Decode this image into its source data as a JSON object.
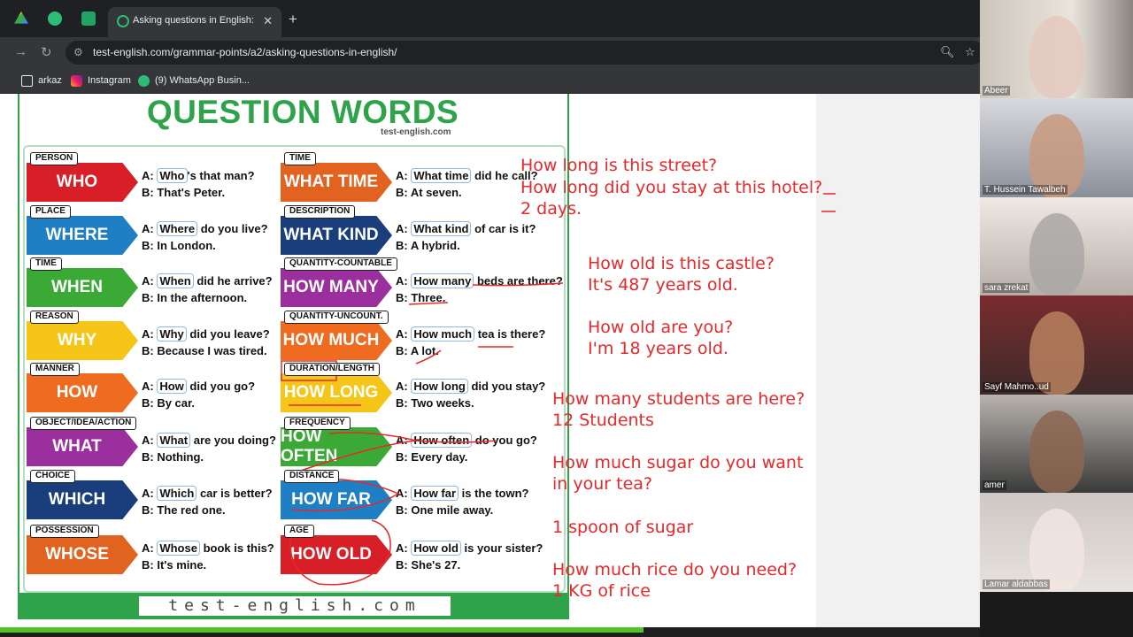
{
  "browser": {
    "active_tab_title": "Asking questions in English: Qu",
    "url": "test-english.com/grammar-points/a2/asking-questions-in-english/",
    "bookmarks": [
      {
        "label": "arkaz",
        "icon": "folder-icon"
      },
      {
        "label": "Instagram",
        "icon": "instagram-icon"
      },
      {
        "label": "(9) WhatsApp Busin...",
        "icon": "whatsapp-icon"
      }
    ],
    "close_glyph": "✕",
    "new_tab_glyph": "+"
  },
  "poster": {
    "title": "QUESTION WORDS",
    "brand": "test-english.com",
    "footer": "test-english.com",
    "cards": [
      {
        "cat": "PERSON",
        "word": "WHO",
        "color": "#d81e26",
        "pre1": "A: ",
        "hl": "Who",
        "post1": "'s that man?",
        "line2": "B: That's Peter."
      },
      {
        "cat": "PLACE",
        "word": "WHERE",
        "color": "#1e7fc4",
        "pre1": "A: ",
        "hl": "Where",
        "post1": " do you live?",
        "line2": "B: In London."
      },
      {
        "cat": "TIME",
        "word": "WHEN",
        "color": "#3aa935",
        "pre1": "A: ",
        "hl": "When",
        "post1": " did he arrive?",
        "line2": "B: In the afternoon."
      },
      {
        "cat": "REASON",
        "word": "WHY",
        "color": "#f5c518",
        "pre1": "A: ",
        "hl": "Why",
        "post1": " did you leave?",
        "line2": "B: Because I was tired."
      },
      {
        "cat": "MANNER",
        "word": "HOW",
        "color": "#ee6b1f",
        "pre1": "A: ",
        "hl": "How",
        "post1": " did you go?",
        "line2": "B: By car."
      },
      {
        "cat": "OBJECT/IDEA/ACTION",
        "word": "WHAT",
        "color": "#9b2f9e",
        "pre1": "A: ",
        "hl": "What",
        "post1": " are you doing?",
        "line2": "B: Nothing."
      },
      {
        "cat": "CHOICE",
        "word": "WHICH",
        "color": "#1a3d7c",
        "pre1": "A: ",
        "hl": "Which",
        "post1": " car is better?",
        "line2": "B: The red one."
      },
      {
        "cat": "POSSESSION",
        "word": "WHOSE",
        "color": "#e2621f",
        "pre1": "A: ",
        "hl": "Whose",
        "post1": " book is this?",
        "line2": "B: It's mine."
      },
      {
        "cat": "TIME",
        "word": "WHAT TIME",
        "color": "#e2621f",
        "pre1": "A: ",
        "hl": "What time",
        "post1": " did he call?",
        "line2": "B: At seven."
      },
      {
        "cat": "DESCRIPTION",
        "word": "WHAT KIND",
        "color": "#1a3d7c",
        "pre1": "A: ",
        "hl": "What kind",
        "post1": " of car is it?",
        "line2": "B: A hybrid."
      },
      {
        "cat": "QUANTITY-COUNTABLE",
        "word": "HOW MANY",
        "color": "#9b2f9e",
        "pre1": "A: ",
        "hl": "How many",
        "post1": " beds are there?",
        "line2": "B: Three."
      },
      {
        "cat": "QUANTITY-UNCOUNT.",
        "word": "HOW MUCH",
        "color": "#ee6b1f",
        "pre1": "A: ",
        "hl": "How much",
        "post1": " tea is there?",
        "line2": "B: A lot."
      },
      {
        "cat": "DURATION/LENGTH",
        "word": "HOW LONG",
        "color": "#f5c518",
        "pre1": "A: ",
        "hl": "How long",
        "post1": " did you stay?",
        "line2": "B: Two weeks."
      },
      {
        "cat": "FREQUENCY",
        "word": "HOW OFTEN",
        "color": "#3aa935",
        "pre1": "A: ",
        "hl": "How often",
        "post1": " do you go?",
        "line2": "B: Every day."
      },
      {
        "cat": "DISTANCE",
        "word": "HOW FAR",
        "color": "#1e7fc4",
        "pre1": "A: ",
        "hl": "How far",
        "post1": " is the town?",
        "line2": "B: One mile away."
      },
      {
        "cat": "AGE",
        "word": "HOW OLD",
        "color": "#d81e26",
        "pre1": "A: ",
        "hl": "How old",
        "post1": " is your sister?",
        "line2": "B: She's 27."
      }
    ]
  },
  "notes": [
    "How long is this street?",
    "How long did you stay at this hotel?",
    "2 days.",
    "How old is this castle?",
    "It's 487 years old.",
    "How old are you?",
    "I'm 18 years old.",
    "How many students are here?",
    "12 Students",
    "How much sugar do you want",
    "in your tea?",
    "1 spoon of sugar",
    "How much rice do you need?",
    "1 KG of rice"
  ],
  "participants": [
    {
      "name": "Abeer"
    },
    {
      "name": "T. Hussein Tawalbeh"
    },
    {
      "name": "sara zrekat"
    },
    {
      "name": "Sayf Mahmo..ud"
    },
    {
      "name": "amer"
    },
    {
      "name": "Lamar aldabbas"
    }
  ]
}
